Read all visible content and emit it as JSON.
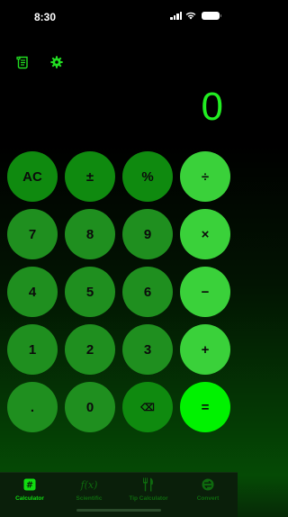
{
  "status": {
    "time": "8:30"
  },
  "display": {
    "value": "0"
  },
  "keys": {
    "ac": "AC",
    "plusminus": "±",
    "percent": "%",
    "divide": "÷",
    "seven": "7",
    "eight": "8",
    "nine": "9",
    "multiply": "×",
    "four": "4",
    "five": "5",
    "six": "6",
    "minus": "−",
    "one": "1",
    "two": "2",
    "three": "3",
    "plus": "+",
    "dot": ".",
    "zero": "0",
    "backspace": "⌫",
    "equals": "="
  },
  "tabs": [
    {
      "label": "Calculator",
      "icon": "hash-icon",
      "active": true
    },
    {
      "label": "Scientific",
      "icon": "function-icon",
      "active": false
    },
    {
      "label": "Tip Calculator",
      "icon": "fork-knife-icon",
      "active": false
    },
    {
      "label": "Convert",
      "icon": "convert-icon",
      "active": false
    }
  ],
  "colors": {
    "accent": "#00f200",
    "display_text": "#22ee22",
    "key_dark": "#0f8a0f",
    "key_operator": "#3ad13a"
  }
}
